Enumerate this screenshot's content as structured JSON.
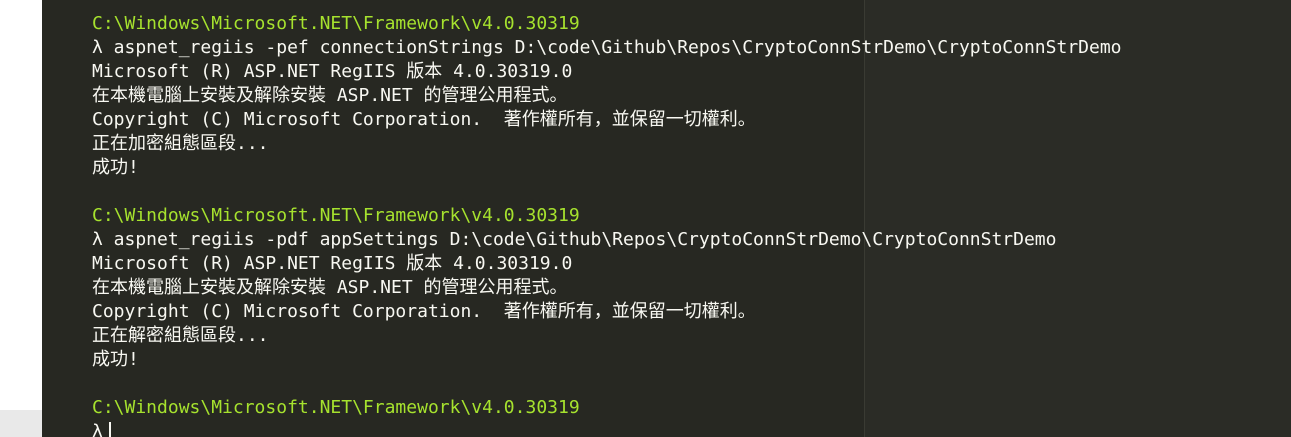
{
  "colors": {
    "background": "#272822",
    "path_text": "#a6e22e",
    "output_text": "#f8f8f2"
  },
  "console": {
    "lines": [
      {
        "type": "path",
        "text": "C:\\Windows\\Microsoft.NET\\Framework\\v4.0.30319"
      },
      {
        "type": "command",
        "text": "λ aspnet_regiis -pef connectionStrings D:\\code\\Github\\Repos\\CryptoConnStrDemo\\CryptoConnStrDemo"
      },
      {
        "type": "output",
        "text": "Microsoft (R) ASP.NET RegIIS 版本 4.0.30319.0"
      },
      {
        "type": "output",
        "text": "在本機電腦上安裝及解除安裝 ASP.NET 的管理公用程式。"
      },
      {
        "type": "output",
        "text": "Copyright (C) Microsoft Corporation.  著作權所有，並保留一切權利。"
      },
      {
        "type": "output",
        "text": "正在加密組態區段..."
      },
      {
        "type": "output",
        "text": "成功!"
      },
      {
        "type": "blank",
        "text": ""
      },
      {
        "type": "path",
        "text": "C:\\Windows\\Microsoft.NET\\Framework\\v4.0.30319"
      },
      {
        "type": "command",
        "text": "λ aspnet_regiis -pdf appSettings D:\\code\\Github\\Repos\\CryptoConnStrDemo\\CryptoConnStrDemo"
      },
      {
        "type": "output",
        "text": "Microsoft (R) ASP.NET RegIIS 版本 4.0.30319.0"
      },
      {
        "type": "output",
        "text": "在本機電腦上安裝及解除安裝 ASP.NET 的管理公用程式。"
      },
      {
        "type": "output",
        "text": "Copyright (C) Microsoft Corporation.  著作權所有，並保留一切權利。"
      },
      {
        "type": "output",
        "text": "正在解密組態區段..."
      },
      {
        "type": "output",
        "text": "成功!"
      },
      {
        "type": "blank",
        "text": ""
      },
      {
        "type": "path",
        "text": "C:\\Windows\\Microsoft.NET\\Framework\\v4.0.30319"
      }
    ],
    "prompt": "λ"
  }
}
